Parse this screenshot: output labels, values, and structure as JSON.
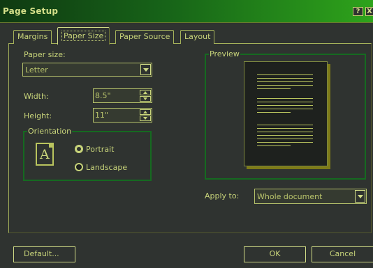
{
  "window": {
    "title": "Page Setup",
    "help_button": "?",
    "close_button": "X"
  },
  "tabs": [
    {
      "label": "Margins"
    },
    {
      "label": "Paper Size",
      "active": true
    },
    {
      "label": "Paper Source"
    },
    {
      "label": "Layout"
    }
  ],
  "paper_size": {
    "label": "Paper size:",
    "value": "Letter"
  },
  "width": {
    "label": "Width:",
    "value": "8.5\""
  },
  "height": {
    "label": "Height:",
    "value": "11\""
  },
  "orientation": {
    "legend": "Orientation",
    "icon_letter": "A",
    "options": [
      {
        "label": "Portrait",
        "checked": true
      },
      {
        "label": "Landscape",
        "checked": false
      }
    ]
  },
  "preview": {
    "legend": "Preview"
  },
  "apply_to": {
    "label": "Apply to:",
    "value": "Whole document"
  },
  "buttons": {
    "default": "Default...",
    "ok": "OK",
    "cancel": "Cancel"
  },
  "colors": {
    "background": "#2f3330",
    "text": "#c8d47a",
    "title_bar_start": "#0f3a12",
    "title_bar_end": "#2ea31b",
    "group_border": "#156a20",
    "page_shadow": "#7d7a18"
  }
}
